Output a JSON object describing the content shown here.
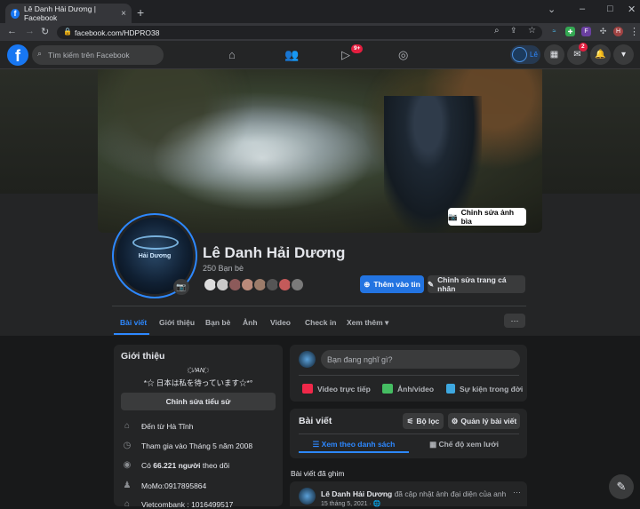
{
  "browser": {
    "tab_title": "Lê Danh Hải Dương | Facebook",
    "tab_close": "×",
    "new_tab": "+",
    "url": "facebook.com/HDPRO38",
    "window_controls": [
      "–",
      "□",
      "✕"
    ],
    "ext_badges": [
      "F",
      "H"
    ]
  },
  "fbnav": {
    "logo": "f",
    "search_placeholder": "Tìm kiếm trên Facebook",
    "watch_badge": "9+",
    "messenger_badge": "2",
    "user_chip_label": "Lê"
  },
  "cover": {
    "edit_button": "Chỉnh sửa ảnh bìa"
  },
  "profile": {
    "avatar_text": "Hải Dương",
    "name": "Lê Danh Hải Dương",
    "friends": "250 Bạn bè",
    "add_story": "Thêm vào tin",
    "edit_profile": "Chỉnh sửa trang cá nhân",
    "more_button": "···"
  },
  "tabs": [
    "Bài viết",
    "Giới thiệu",
    "Bạn bè",
    "Ảnh",
    "Video",
    "Check in",
    "Xem thêm ▾"
  ],
  "intro": {
    "title": "Giới thiệu",
    "bio_line1": "҉҉ 𝆺𝅥𝅯AN ҉",
    "bio_line2": "*☆ 日本は私を待っています☆*°",
    "edit_bio": "Chỉnh sửa tiểu sử",
    "rows": [
      {
        "icon": "home-icon",
        "text": "Đến từ Hà Tĩnh"
      },
      {
        "icon": "clock-icon",
        "text": "Tham gia vào Tháng 5 năm 2008"
      },
      {
        "icon": "rss-icon",
        "text_prefix": "Có ",
        "text_bold": "66.221 người",
        "text_suffix": " theo dõi"
      },
      {
        "icon": "person-icon",
        "text": "MoMo:0917895864"
      },
      {
        "icon": "bank-icon",
        "text": "Vietcombank : 1016499517"
      }
    ]
  },
  "composer": {
    "placeholder": "Bạn đang nghĩ gì?",
    "actions": [
      "Video trực tiếp",
      "Ảnh/video",
      "Sự kiện trong đời"
    ]
  },
  "posts": {
    "title": "Bài viết",
    "filter": "Bộ lọc",
    "manage": "Quản lý bài viết",
    "view_list": "Xem theo danh sách",
    "view_grid": "Chế độ xem lưới",
    "pinned_label": "Bài viết đã ghim",
    "post_author": "Lê Danh Hải Dương",
    "post_action": " đã cập nhật ảnh đại diện của anh ấy.",
    "post_date": "15 tháng 5, 2021 · 🌐",
    "post_more": "···"
  },
  "colors": {
    "accent": "#2d88ff",
    "primary_button": "#2374e1",
    "surface": "#242526",
    "background": "#18191a",
    "badge": "#e41e3f"
  }
}
